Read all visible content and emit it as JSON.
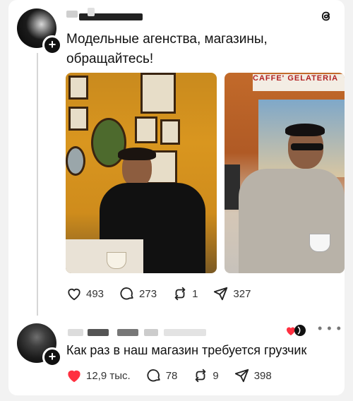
{
  "post": {
    "text": "Модельные агенства, магазины, обращайтесь!",
    "stats": {
      "likes": "493",
      "comments": "273",
      "reposts": "1",
      "shares": "327"
    }
  },
  "reply": {
    "text": "Как раз в наш магазин требуется грузчик",
    "stats": {
      "likes": "12,9 тыс.",
      "comments": "78",
      "reposts": "9",
      "shares": "398"
    }
  },
  "photo2_sign": "CAFFE' GELATERIA",
  "colors": {
    "like_red": "#ff3040",
    "text": "#111111",
    "muted": "#555555"
  },
  "icons": [
    "threads-logo-icon",
    "heart-icon",
    "comment-icon",
    "repost-icon",
    "share-icon",
    "more-icon",
    "plus-icon"
  ]
}
